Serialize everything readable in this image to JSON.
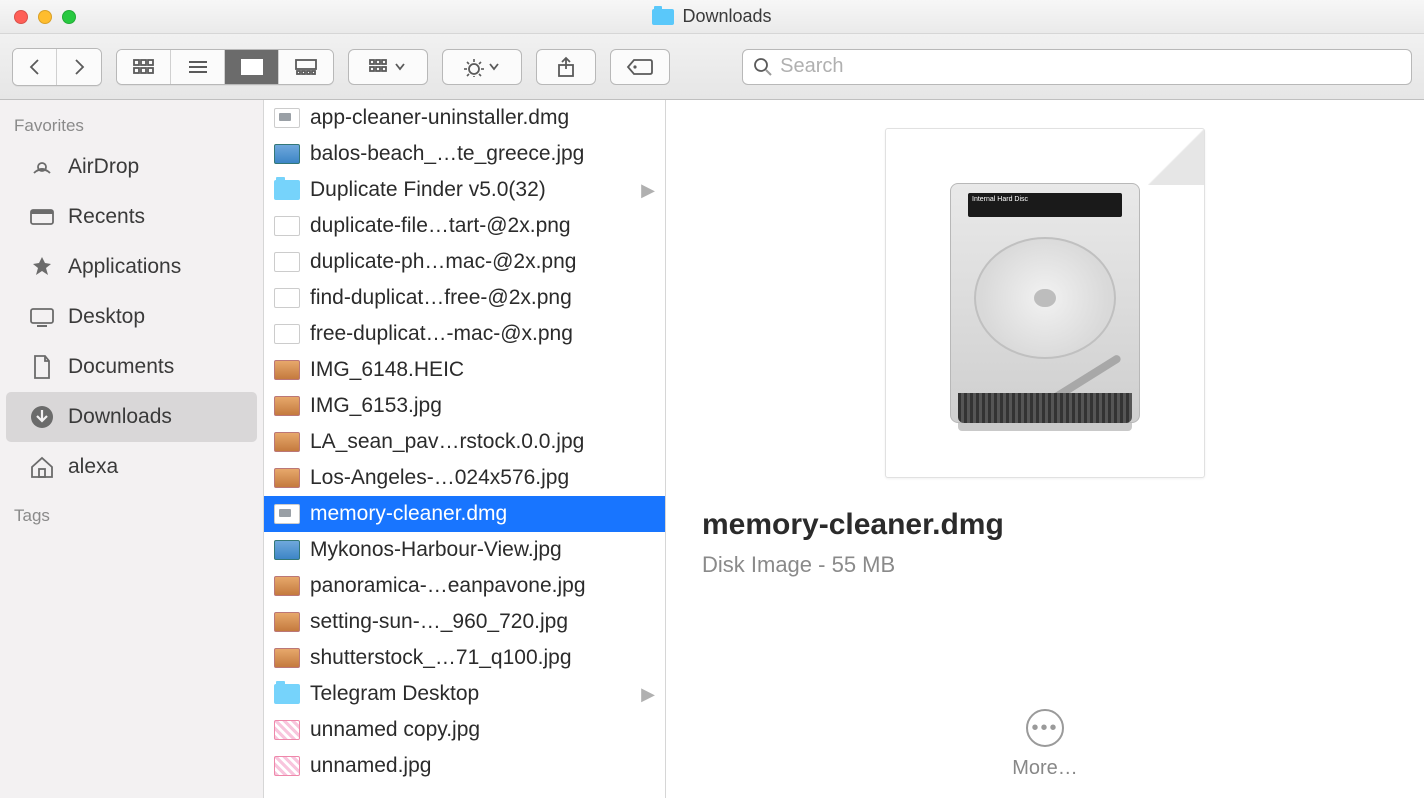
{
  "window": {
    "title": "Downloads"
  },
  "search": {
    "placeholder": "Search"
  },
  "sidebar": {
    "favorites_header": "Favorites",
    "tags_header": "Tags",
    "items": [
      {
        "label": "AirDrop",
        "icon": "airdrop-icon",
        "selected": false
      },
      {
        "label": "Recents",
        "icon": "recents-icon",
        "selected": false
      },
      {
        "label": "Applications",
        "icon": "applications-icon",
        "selected": false
      },
      {
        "label": "Desktop",
        "icon": "desktop-icon",
        "selected": false
      },
      {
        "label": "Documents",
        "icon": "documents-icon",
        "selected": false
      },
      {
        "label": "Downloads",
        "icon": "downloads-icon",
        "selected": true
      },
      {
        "label": "alexa",
        "icon": "home-icon",
        "selected": false
      }
    ]
  },
  "files": [
    {
      "name": "app-cleaner-uninstaller.dmg",
      "type": "dmg",
      "selected": false,
      "expandable": false
    },
    {
      "name": "balos-beach_…te_greece.jpg",
      "type": "img2",
      "selected": false,
      "expandable": false
    },
    {
      "name": "Duplicate Finder v5.0(32)",
      "type": "folder",
      "selected": false,
      "expandable": true
    },
    {
      "name": "duplicate-file…tart-@2x.png",
      "type": "png",
      "selected": false,
      "expandable": false
    },
    {
      "name": "duplicate-ph…mac-@2x.png",
      "type": "png",
      "selected": false,
      "expandable": false
    },
    {
      "name": "find-duplicat…free-@2x.png",
      "type": "png",
      "selected": false,
      "expandable": false
    },
    {
      "name": "free-duplicat…-mac-@x.png",
      "type": "png",
      "selected": false,
      "expandable": false
    },
    {
      "name": "IMG_6148.HEIC",
      "type": "img",
      "selected": false,
      "expandable": false
    },
    {
      "name": "IMG_6153.jpg",
      "type": "img",
      "selected": false,
      "expandable": false
    },
    {
      "name": "LA_sean_pav…rstock.0.0.jpg",
      "type": "img",
      "selected": false,
      "expandable": false
    },
    {
      "name": "Los-Angeles-…024x576.jpg",
      "type": "img",
      "selected": false,
      "expandable": false
    },
    {
      "name": "memory-cleaner.dmg",
      "type": "dmg",
      "selected": true,
      "expandable": false
    },
    {
      "name": "Mykonos-Harbour-View.jpg",
      "type": "img2",
      "selected": false,
      "expandable": false
    },
    {
      "name": "panoramica-…eanpavone.jpg",
      "type": "img",
      "selected": false,
      "expandable": false
    },
    {
      "name": "setting-sun-…_960_720.jpg",
      "type": "img",
      "selected": false,
      "expandable": false
    },
    {
      "name": "shutterstock_…71_q100.jpg",
      "type": "img",
      "selected": false,
      "expandable": false
    },
    {
      "name": "Telegram Desktop",
      "type": "folder",
      "selected": false,
      "expandable": true
    },
    {
      "name": "unnamed copy.jpg",
      "type": "pink",
      "selected": false,
      "expandable": false
    },
    {
      "name": "unnamed.jpg",
      "type": "pink",
      "selected": false,
      "expandable": false
    }
  ],
  "preview": {
    "filename": "memory-cleaner.dmg",
    "subtitle": "Disk Image - 55 MB",
    "more_label": "More…",
    "hdd_label": "Internal Hard Disc"
  }
}
